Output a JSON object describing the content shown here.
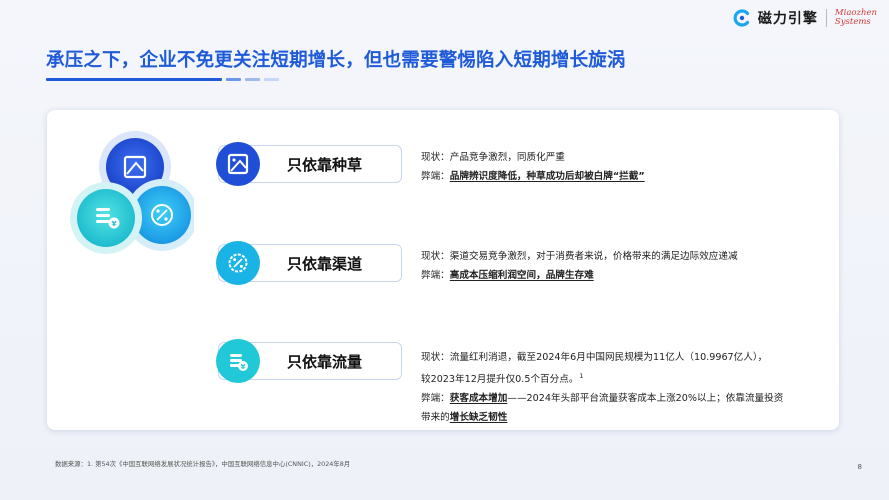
{
  "header": {
    "title": "承压之下，企业不免更关注短期增长，但也需要警惕陷入短期增长旋涡"
  },
  "brand": {
    "name_cn": "磁力引擎",
    "name_en_line1": "Miaozhen",
    "name_en_line2": "Systems",
    "accent": "#1f5bd9"
  },
  "items": [
    {
      "label": "只依靠种草",
      "icon": "image-frame-icon",
      "status_prefix": "现状：",
      "status": "产品竞争激烈，同质化严重",
      "drawback_prefix": "弊端：",
      "drawback": "品牌辨识度降低，种草成功后却被白牌“拦截”"
    },
    {
      "label": "只依靠渠道",
      "icon": "discount-badge-icon",
      "status_prefix": "现状：",
      "status": "渠道交易竞争激烈，对于消费者来说，价格带来的满足边际效应递减",
      "drawback_prefix": "弊端：",
      "drawback": "高成本压缩利润空间，品牌生存难"
    },
    {
      "label": "只依靠流量",
      "icon": "coin-stack-icon",
      "status_prefix": "现状：",
      "status_line1": "流量红利消退，截至2024年6月中国网民规模为11亿人（10.9967亿人），",
      "status_line2": "较2023年12月提升仅0.5个百分点。",
      "footnote_mark": "1",
      "drawback_prefix": "弊端：",
      "drawback_strong1": "获客成本增加",
      "drawback_rest": "——2024年头部平台流量获客成本上涨20%以上；依靠流量投资",
      "drawback_line2_prefix": "带来的",
      "drawback_strong2": "增长缺乏韧性"
    }
  ],
  "footer": {
    "source": "数据来源：1. 第54次《中国互联网络发展状况统计报告》，中国互联网络信息中心(CNNIC)，2024年8月",
    "page": "8"
  }
}
